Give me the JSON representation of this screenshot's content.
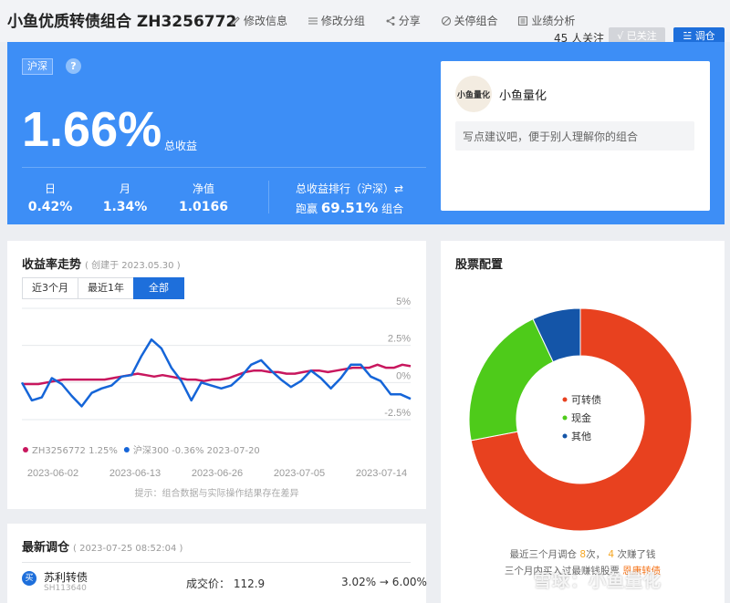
{
  "header": {
    "title": "小鱼优质转债组合 ZH3256772",
    "actions": [
      "修改信息",
      "修改分组",
      "分享",
      "关停组合",
      "业绩分析"
    ],
    "follow_count": "45 人关注",
    "followed_label": "√ 已关注",
    "adjust_label": "☱ 调仓"
  },
  "hero": {
    "market_tag": "沪深",
    "help": "?",
    "total_return": "1.66%",
    "total_return_label": "总收益",
    "stats": [
      {
        "label": "日",
        "value": "0.42%"
      },
      {
        "label": "月",
        "value": "1.34%"
      },
      {
        "label": "净值",
        "value": "1.0166"
      }
    ],
    "rank_label": "总收益排行（沪深）⇄",
    "rank_prefix": "跑赢",
    "rank_value": "69.51%",
    "rank_suffix": "组合"
  },
  "owner": {
    "avatar_text": "小鱼量化",
    "name": "小鱼量化",
    "desc": "写点建议吧，便于别人理解你的组合"
  },
  "trend": {
    "title": "收益率走势",
    "created": "( 创建于 2023.05.30 )",
    "tabs": [
      "近3个月",
      "最近1年",
      "全部"
    ],
    "active_tab": 2,
    "note": "提示：组合数据与实际操作结果存在差异"
  },
  "chart_data": {
    "type": "line",
    "x": [
      "2023-06-02",
      "2023-06-13",
      "2023-06-26",
      "2023-07-05",
      "2023-07-14"
    ],
    "y_ticks": [
      "5%",
      "2.5%",
      "0%",
      "-2.5%"
    ],
    "ylim": [
      -2.5,
      5
    ],
    "series": [
      {
        "name": "ZH3256772",
        "legend": "ZH3256772 1.25%",
        "color": "#c8175e",
        "values": [
          -0.1,
          -0.1,
          -0.1,
          0.0,
          0.1,
          0.2,
          0.2,
          0.2,
          0.2,
          0.2,
          0.2,
          0.3,
          0.4,
          0.5,
          0.6,
          0.5,
          0.4,
          0.5,
          0.4,
          0.3,
          0.2,
          0.2,
          0.1,
          0.2,
          0.2,
          0.3,
          0.5,
          0.7,
          0.8,
          0.8,
          0.7,
          0.7,
          0.6,
          0.6,
          0.7,
          0.8,
          0.8,
          0.7,
          0.8,
          0.9,
          1.0,
          1.0,
          1.0,
          1.2,
          1.0,
          1.0,
          1.2,
          1.1
        ]
      },
      {
        "name": "沪深300",
        "legend": "沪深300 -0.36% 2023-07-20",
        "color": "#1565d8",
        "values": [
          0.0,
          -1.2,
          -1.0,
          0.3,
          -0.1,
          -0.9,
          -1.6,
          -0.7,
          -0.4,
          -0.2,
          0.4,
          0.5,
          1.8,
          2.9,
          2.3,
          1.0,
          0.1,
          -1.2,
          0.0,
          -0.2,
          -0.4,
          -0.2,
          0.4,
          1.2,
          1.5,
          0.8,
          0.2,
          -0.3,
          0.1,
          0.8,
          0.3,
          -0.4,
          0.3,
          1.2,
          1.2,
          0.4,
          0.1,
          -0.8,
          -0.8,
          -1.1
        ]
      }
    ]
  },
  "allocation": {
    "title": "股票配置",
    "chart_data": {
      "type": "pie",
      "labels": [
        "可转债",
        "现金",
        "其他"
      ],
      "values": [
        0.72,
        0.21,
        0.07
      ],
      "colors": [
        "#e8411f",
        "#4ecb1a",
        "#1455a8"
      ]
    },
    "summary_a": "最近三个月调仓",
    "summary_count": "8",
    "summary_b": "次，",
    "summary_win": "4",
    "summary_c": "次赚了钱",
    "summary2": "三个月内买入过最赚钱股票",
    "summary2_link": "恩康转债"
  },
  "rebalance": {
    "title": "最新调仓",
    "time": "( 2023-07-25 08:52:04 )",
    "badge": "买",
    "stock_name": "苏利转债",
    "stock_code": "SH113640",
    "price": "成交价： 112.9",
    "change": "3.02% → 6.00%"
  },
  "watermark": "雪球：小鱼量化"
}
